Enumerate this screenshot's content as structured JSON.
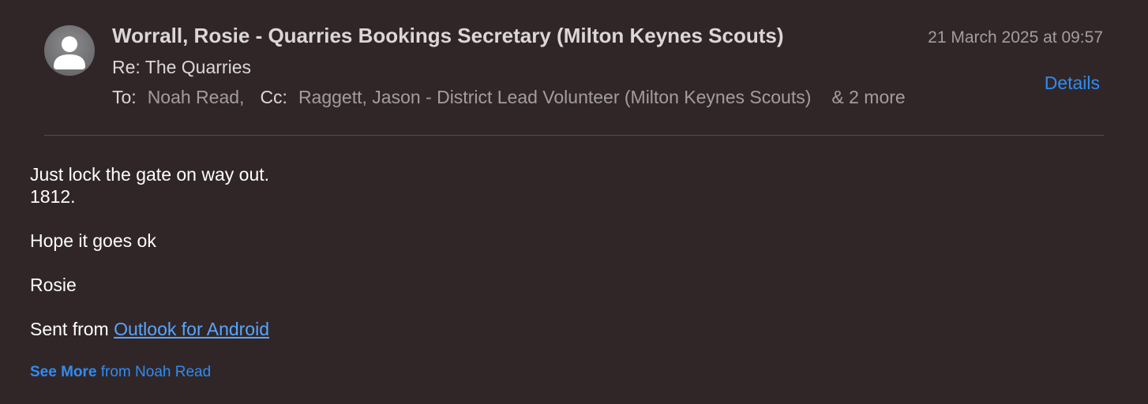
{
  "header": {
    "sender": "Worrall, Rosie - Quarries Bookings Secretary (Milton Keynes Scouts)",
    "date": "21 March 2025 at 09:57",
    "subject": "Re: The Quarries",
    "to_label": "To:",
    "to_value": "Noah Read,",
    "cc_label": "Cc:",
    "cc_value": "Raggett, Jason - District Lead Volunteer (Milton Keynes Scouts)",
    "more": "& 2 more",
    "details_label": "Details",
    "avatar_icon": "person-icon"
  },
  "body": {
    "line1": "Just lock the gate on way out.",
    "line2": "1812.",
    "line3": "Hope it goes ok",
    "line4": "Rosie",
    "sent_prefix": "Sent from ",
    "sent_link": "Outlook for Android"
  },
  "footer": {
    "see_more_bold": "See More",
    "see_more_rest": " from Noah Read"
  },
  "colors": {
    "background": "#302628",
    "accent": "#2f8cf3",
    "link": "#58a6ff"
  }
}
